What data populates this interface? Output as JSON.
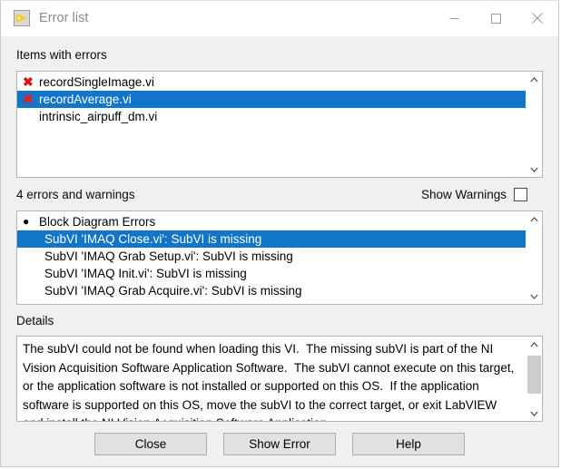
{
  "window": {
    "title": "Error list",
    "icon": "labview-vi-icon",
    "controls": [
      {
        "name": "minimize-button",
        "icon": "minimize-icon",
        "label": "Minimize"
      },
      {
        "name": "maximize-button",
        "icon": "maximize-icon",
        "label": "Maximize"
      },
      {
        "name": "close-window-button",
        "icon": "close-icon",
        "label": "Close"
      }
    ]
  },
  "items_section": {
    "label": "Items with errors",
    "items": [
      {
        "text": "recordSingleImage.vi",
        "has_error_mark": true,
        "selected": false
      },
      {
        "text": "recordAverage.vi",
        "has_error_mark": true,
        "selected": true
      },
      {
        "text": "intrinsic_airpuff_dm.vi",
        "has_error_mark": false,
        "selected": false
      }
    ]
  },
  "errors_section": {
    "summary": "4 errors and warnings",
    "show_warnings_label": "Show Warnings",
    "show_warnings_checked": false,
    "items": [
      {
        "text": "Block Diagram Errors",
        "type": "header",
        "selected": false
      },
      {
        "text": "SubVI 'IMAQ Close.vi': SubVI is missing",
        "type": "child",
        "selected": true
      },
      {
        "text": "SubVI 'IMAQ Grab Setup.vi': SubVI is missing",
        "type": "child",
        "selected": false
      },
      {
        "text": "SubVI 'IMAQ Init.vi': SubVI is missing",
        "type": "child",
        "selected": false
      },
      {
        "text": "SubVI 'IMAQ Grab Acquire.vi': SubVI is missing",
        "type": "child",
        "selected": false
      }
    ]
  },
  "details_section": {
    "label": "Details",
    "text": "The subVI could not be found when loading this VI.  The missing subVI is part of the NI Vision Acquisition Software Application Software.  The subVI cannot execute on this target, or the application software is not installed or supported on this OS.  If the application software is supported on this OS, move the subVI to the correct target, or exit LabVIEW and install the NI Vision Acquisition Software Application"
  },
  "footer": {
    "buttons": [
      {
        "name": "close-button",
        "label": "Close"
      },
      {
        "name": "show-error-button",
        "label": "Show Error"
      },
      {
        "name": "help-button",
        "label": "Help"
      }
    ]
  },
  "colors": {
    "selection_blue": "#1175c8",
    "error_red": "#d81414",
    "window_bg": "#f0f0f0",
    "titlebar_bg": "#ffffff"
  }
}
